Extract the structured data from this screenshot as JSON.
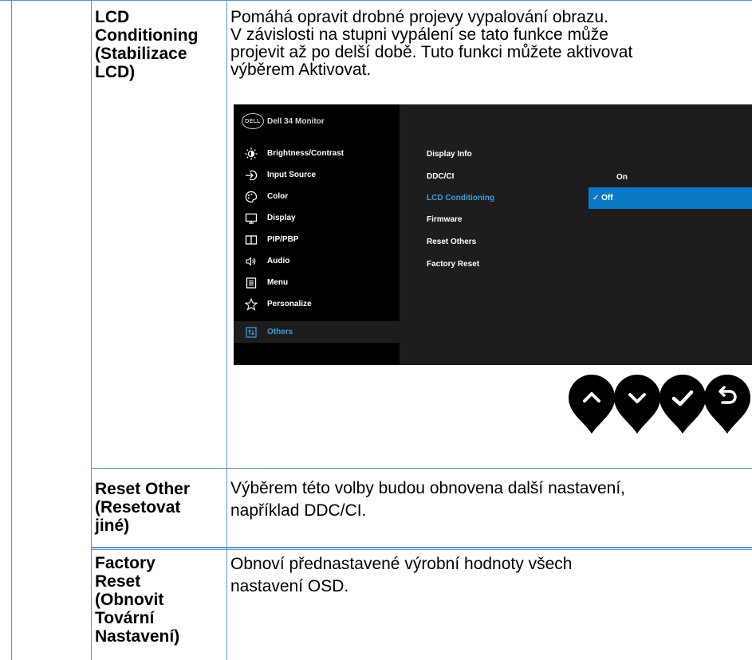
{
  "rows": [
    {
      "label": "LCD Conditioning (Stabilizace LCD)",
      "label_lines": [
        "LCD",
        "Conditioning",
        "(Stabilizace",
        "LCD)"
      ],
      "description_lines": [
        "Pomáhá opravit drobné projevy vypalování obrazu.",
        "V závislosti na stupni vypálení se tato funkce může",
        "projevit až po delší době. Tuto funkci můžete aktivovat",
        "výběrem Aktivovat."
      ]
    },
    {
      "label_lines": [
        "Reset Other",
        "(Resetovat",
        "jiné)"
      ],
      "description_lines": [
        "Výběrem této volby budou obnovena další nastavení,",
        "například DDC/CI."
      ]
    },
    {
      "label_lines": [
        "Factory",
        "Reset",
        "(Obnovit",
        "Tovární",
        "Nastavení)"
      ],
      "description_lines": [
        "Obnoví přednastavené výrobní hodnoty všech",
        "nastavení OSD."
      ]
    }
  ],
  "osd": {
    "logo_text": "DELL",
    "title": "Dell 34 Monitor",
    "menu": [
      {
        "label": "Brightness/Contrast",
        "icon": "brightness-icon"
      },
      {
        "label": "Input Source",
        "icon": "input-source-icon"
      },
      {
        "label": "Color",
        "icon": "color-palette-icon"
      },
      {
        "label": "Display",
        "icon": "display-monitor-icon"
      },
      {
        "label": "PIP/PBP",
        "icon": "pip-pbp-icon"
      },
      {
        "label": "Audio",
        "icon": "speaker-icon"
      },
      {
        "label": "Menu",
        "icon": "menu-list-icon"
      },
      {
        "label": "Personalize",
        "icon": "star-icon"
      },
      {
        "label": "Others",
        "icon": "others-icon",
        "active": true
      }
    ],
    "submenu": [
      "Display Info",
      "DDC/CI",
      "LCD Conditioning",
      "Firmware",
      "Reset Others",
      "Factory Reset"
    ],
    "selected_submenu": "LCD Conditioning",
    "options": {
      "on": "On",
      "off": "✓ Off"
    },
    "colors": {
      "highlight": "#0b79c6",
      "active_text": "#3a9fd8",
      "panel": "#1d1d1d"
    }
  },
  "buttons": [
    "chevron-up-icon",
    "chevron-down-icon",
    "checkmark-icon",
    "back-arrow-icon"
  ]
}
